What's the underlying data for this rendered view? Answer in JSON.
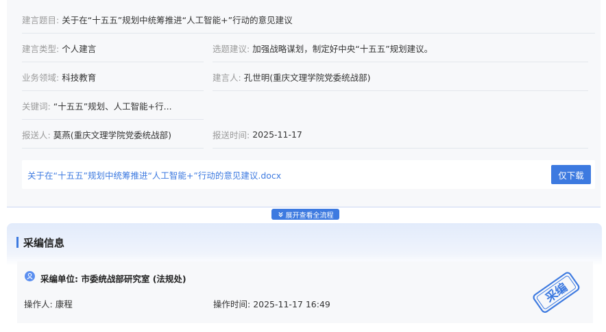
{
  "proposal": {
    "title": {
      "label": "建言题目:",
      "value": "关于在“十五五”规划中统筹推进“人工智能+”行动的意见建议"
    },
    "type": {
      "label": "建言类型:",
      "value": "个人建言"
    },
    "topic": {
      "label": "选题建议:",
      "value": "加强战略谋划，制定好中央“十五五”规划建议。"
    },
    "field": {
      "label": "业务领域:",
      "value": "科技教育"
    },
    "proposer": {
      "label": "建言人:",
      "value": "孔世明(重庆文理学院党委统战部)"
    },
    "keywords": {
      "label": "关键词:",
      "value": "“十五五”规划、人工智能+行..."
    },
    "submitter": {
      "label": "报送人:",
      "value": "莫燕(重庆文理学院党委统战部)"
    },
    "submit_time": {
      "label": "报送时间:",
      "value": "2025-11-17"
    },
    "attachment": {
      "filename": "关于在“十五五”规划中统筹推进“人工智能+”行动的意见建议.docx",
      "download_label": "仅下载"
    }
  },
  "expand": {
    "label": "展开查看全流程",
    "icon": "double-chevron-down-icon"
  },
  "editing": {
    "section_title": "采编信息",
    "unit_label": "采编单位:",
    "unit_value": "市委统战部研究室 (法规处)",
    "operator_label": "操作人:",
    "operator_value": "康程",
    "op_time_label": "操作时间:",
    "op_time_value": "2025-11-17 16:49",
    "stamp_text": "采编",
    "icon": "person-icon"
  },
  "colors": {
    "accent": "#3d7ae0",
    "label_gray": "#9a9a9a",
    "card_bg": "#f7f8fa"
  }
}
